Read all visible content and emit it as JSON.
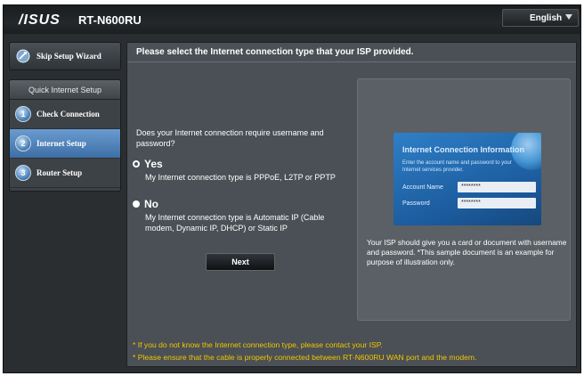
{
  "header": {
    "brand": "/ISUS",
    "model": "RT-N600RU",
    "language": "English"
  },
  "sidebar": {
    "skip_wizard": "Skip Setup Wizard",
    "quick_setup_title": "Quick Internet Setup",
    "steps": [
      {
        "label": "Check Connection",
        "active": false
      },
      {
        "label": "Internet Setup",
        "active": true
      },
      {
        "label": "Router Setup",
        "active": false
      }
    ]
  },
  "main": {
    "title": "Please select the Internet connection type that your ISP provided.",
    "question": "Does your Internet connection require username and password?",
    "options": [
      {
        "label": "Yes",
        "selected": true,
        "description": "My Internet connection type is PPPoE, L2TP or PPTP"
      },
      {
        "label": "No",
        "selected": false,
        "description": "My Internet connection type is Automatic IP (Cable modem, Dynamic IP, DHCP) or Static IP"
      }
    ],
    "next_button": "Next",
    "illustration": {
      "title": "Internet Connection Information",
      "description": "Enter the account name and password to your Internet services provider.",
      "fields": [
        {
          "label": "Account Name",
          "value": "********"
        },
        {
          "label": "Password",
          "value": "********"
        }
      ]
    },
    "illustration_caption": "Your ISP should give you a card or document with username and password. *This sample document is an example for purpose of illustration only.",
    "notes": [
      "* If you do not know the Internet connection type, please contact your ISP.",
      "* Please ensure that the cable is properly connected between RT-N600RU WAN port and the modem."
    ]
  },
  "colors": {
    "active_step": "#4f82ba",
    "note_text": "#f2c600",
    "panel_bg": "#4a5055"
  }
}
